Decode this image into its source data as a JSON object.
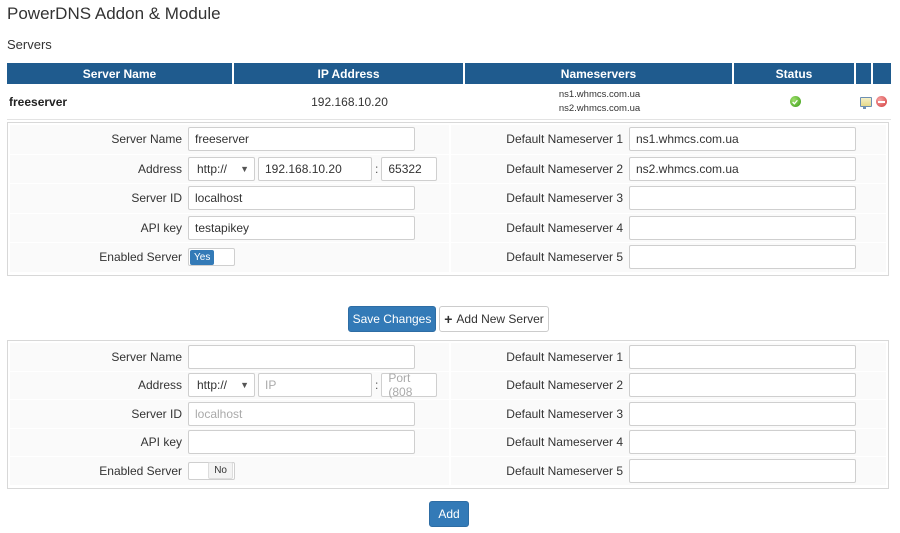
{
  "page": {
    "title": "PowerDNS Addon & Module",
    "section": "Servers"
  },
  "table": {
    "headers": [
      "Server Name",
      "IP Address",
      "Nameservers",
      "Status",
      "",
      ""
    ],
    "rows": [
      {
        "name": "freeserver",
        "ip": "192.168.10.20",
        "ns1": "ns1.whmcs.com.ua",
        "ns2": "ns2.whmcs.com.ua",
        "status": "ok"
      }
    ]
  },
  "edit_form": {
    "server_name_label": "Server Name",
    "server_name": "freeserver",
    "address_label": "Address",
    "protocol": "http://",
    "ip": "192.168.10.20",
    "port": "65322",
    "server_id_label": "Server ID",
    "server_id": "localhost",
    "api_key_label": "API key",
    "api_key": "testapikey",
    "enabled_label": "Enabled Server",
    "enabled": "Yes",
    "ns1_label": "Default Nameserver 1",
    "ns1": "ns1.whmcs.com.ua",
    "ns2_label": "Default Nameserver 2",
    "ns2": "ns2.whmcs.com.ua",
    "ns3_label": "Default Nameserver 3",
    "ns3": "",
    "ns4_label": "Default Nameserver 4",
    "ns4": "",
    "ns5_label": "Default Nameserver 5",
    "ns5": ""
  },
  "actions": {
    "save": "Save Changes",
    "add_new": "Add New Server",
    "add": "Add"
  },
  "new_form": {
    "server_name_label": "Server Name",
    "address_label": "Address",
    "protocol": "http://",
    "ip_placeholder": "IP",
    "port_placeholder": "Port (808",
    "server_id_label": "Server ID",
    "server_id_placeholder": "localhost",
    "api_key_label": "API key",
    "enabled_label": "Enabled Server",
    "enabled": "No",
    "ns1_label": "Default Nameserver 1",
    "ns2_label": "Default Nameserver 2",
    "ns3_label": "Default Nameserver 3",
    "ns4_label": "Default Nameserver 4",
    "ns5_label": "Default Nameserver 5"
  },
  "colors": {
    "header_bg": "#1f5b8e",
    "primary": "#337ab7"
  }
}
